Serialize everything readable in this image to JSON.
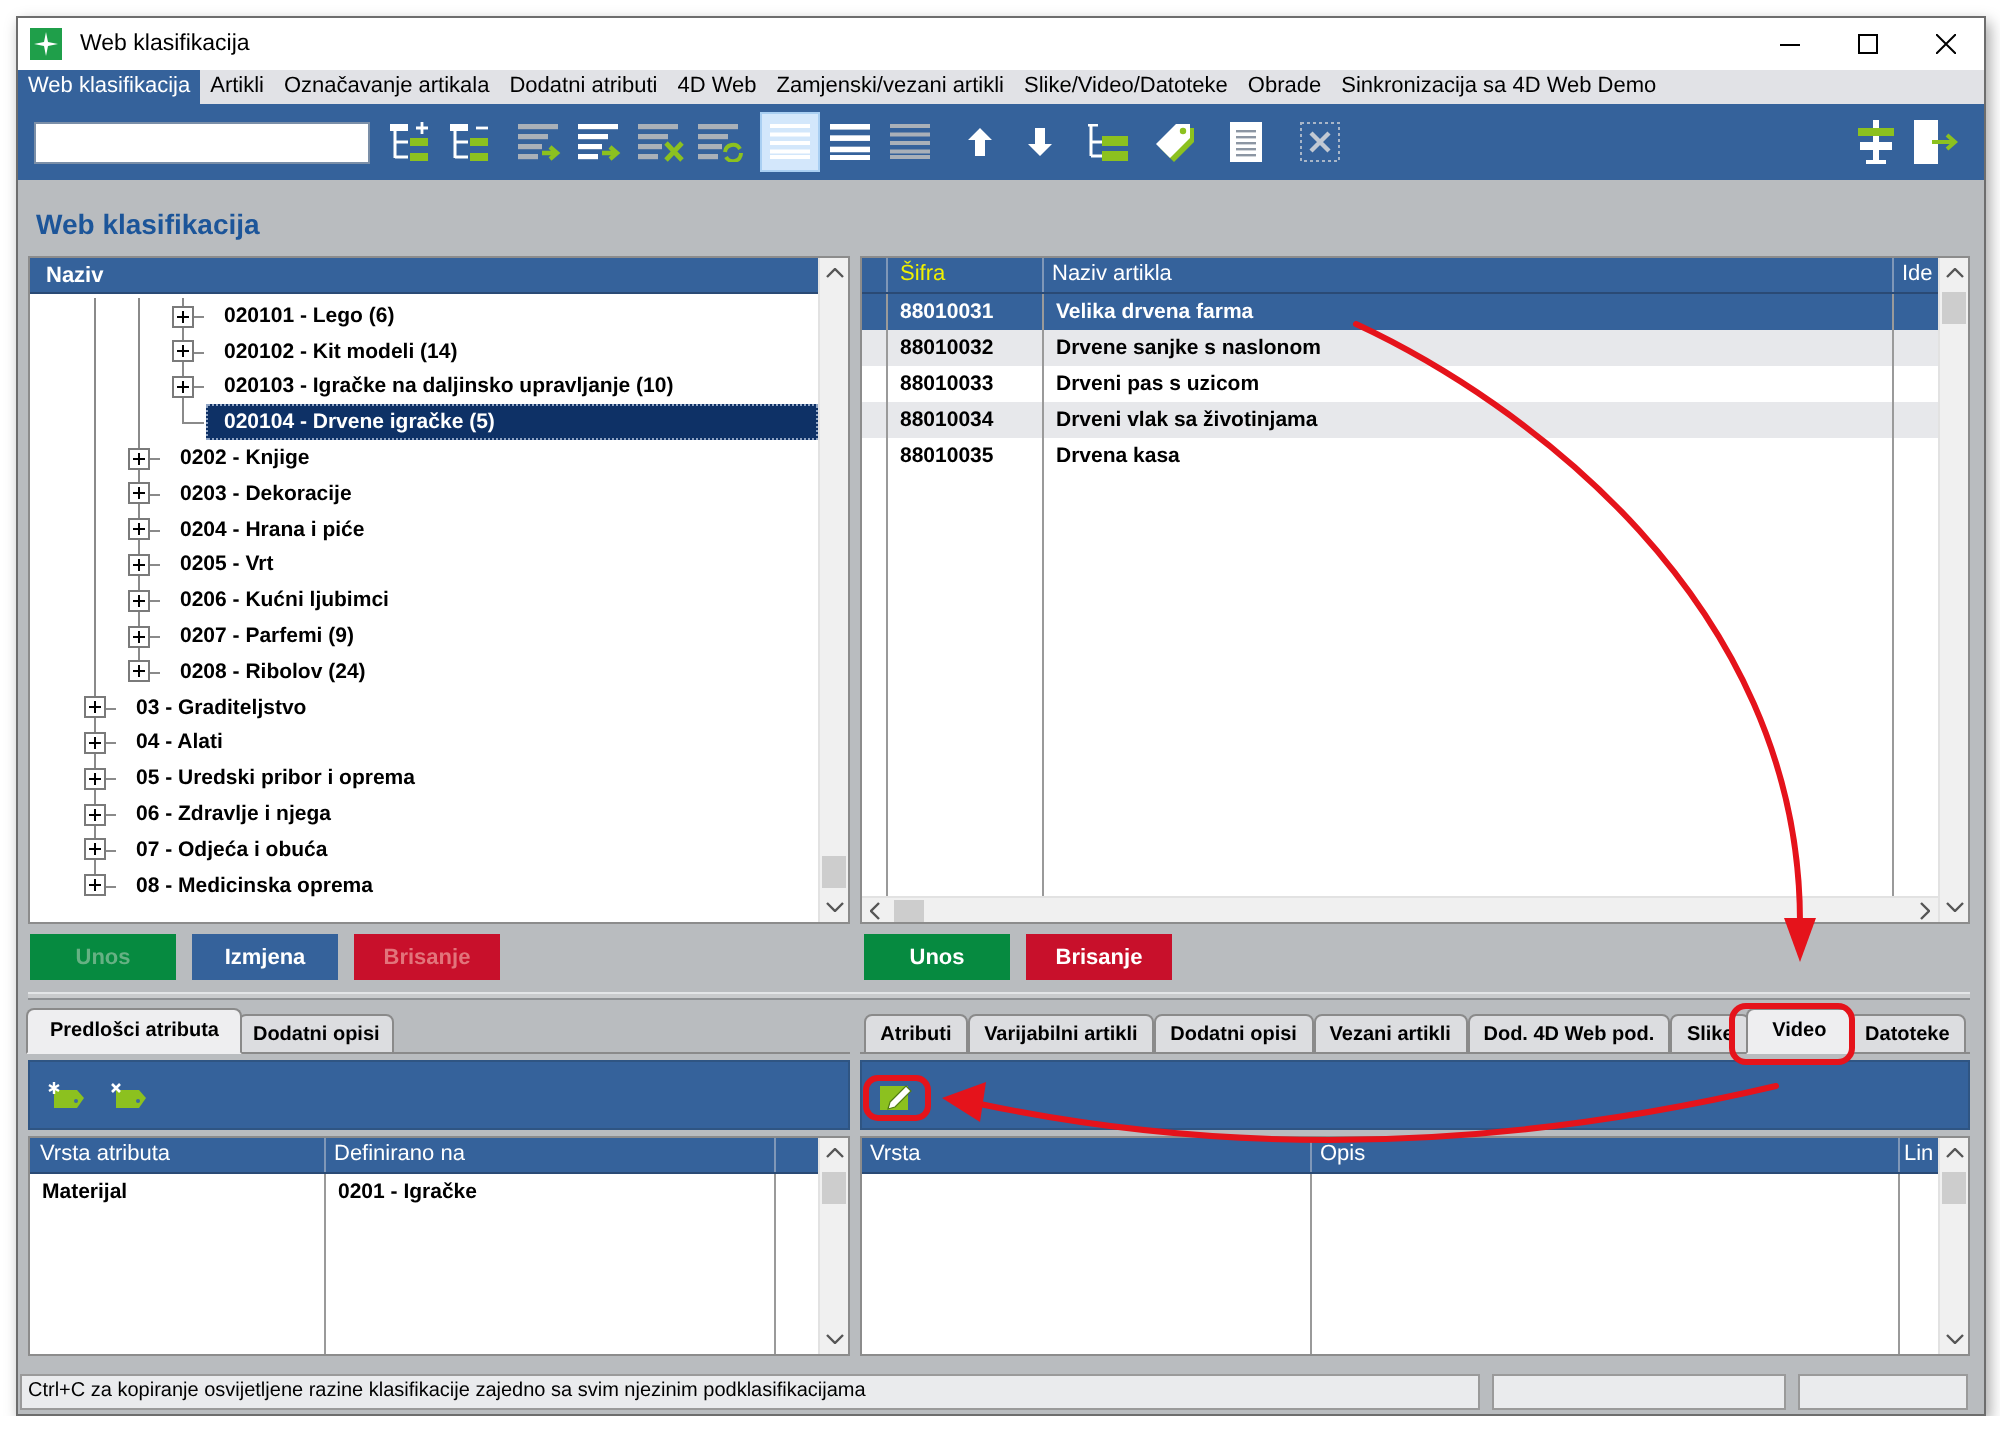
{
  "window": {
    "title": "Web klasifikacija"
  },
  "menu": [
    {
      "label": "Web klasifikacija",
      "selected": true
    },
    {
      "label": "Artikli",
      "selected": false
    },
    {
      "label": "Označavanje artikala",
      "selected": false
    },
    {
      "label": "Dodatni atributi",
      "selected": false
    },
    {
      "label": "4D Web",
      "selected": false
    },
    {
      "label": "Zamjenski/vezani artikli",
      "selected": false
    },
    {
      "label": "Slike/Video/Datoteke",
      "selected": false
    },
    {
      "label": "Obrade",
      "selected": false
    },
    {
      "label": "Sinkronizacija sa 4D Web Demo",
      "selected": false
    }
  ],
  "toolbar": {
    "view_buttons": [
      {
        "selected": true
      },
      {
        "selected": false
      },
      {
        "selected": false
      }
    ]
  },
  "heading": "Web klasifikacija",
  "tree": {
    "header": "Naziv",
    "items": [
      {
        "children": [
          {
            "children": [
              {
                "label": "020101 - Lego (6)",
                "expanded": false,
                "selected": false
              },
              {
                "label": "020102 - Kit modeli (14)",
                "expanded": false,
                "selected": false
              },
              {
                "label": "020103 - Igračke na daljinsko upravljanje (10)",
                "expanded": false,
                "selected": false
              },
              {
                "label": "020104 - Drvene igračke (5)",
                "selected": true
              }
            ]
          },
          {
            "label": "0202 - Knjige",
            "expanded": false,
            "selected": false
          },
          {
            "label": "0203 - Dekoracije",
            "expanded": false,
            "selected": false
          },
          {
            "label": "0204 - Hrana i piće",
            "expanded": false,
            "selected": false
          },
          {
            "label": "0205 - Vrt",
            "expanded": false,
            "selected": false
          },
          {
            "label": "0206 - Kućni ljubimci",
            "expanded": false,
            "selected": false
          },
          {
            "label": "0207 - Parfemi (9)",
            "expanded": false,
            "selected": false
          },
          {
            "label": "0208 - Ribolov (24)",
            "expanded": false,
            "selected": false
          }
        ]
      },
      {
        "label": "03 - Graditeljstvo",
        "expanded": false,
        "selected": false
      },
      {
        "label": "04 - Alati",
        "expanded": false,
        "selected": false
      },
      {
        "label": "05 - Uredski pribor i oprema",
        "expanded": false,
        "selected": false
      },
      {
        "label": "06 - Zdravlje i njega",
        "expanded": false,
        "selected": false
      },
      {
        "label": "07 - Odjeća i obuća",
        "expanded": false,
        "selected": false
      },
      {
        "label": "08 - Medicinska oprema",
        "expanded": false,
        "selected": false
      }
    ]
  },
  "tree_buttons": [
    {
      "label": "Unos",
      "kind": "add",
      "disabled": true
    },
    {
      "label": "Izmjena",
      "kind": "edit",
      "disabled": false
    },
    {
      "label": "Brisanje",
      "kind": "delete",
      "disabled": true
    }
  ],
  "articles": {
    "columns": [
      {
        "label": "Šifra",
        "highlighted": true
      },
      {
        "label": "Naziv artikla",
        "highlighted": false
      },
      {
        "label": "Ide",
        "highlighted": false
      }
    ],
    "rows": [
      {
        "cells": [
          "88010031",
          "Velika drvena farma"
        ],
        "selected": true
      },
      {
        "cells": [
          "88010032",
          "Drvene sanjke s naslonom"
        ],
        "selected": false
      },
      {
        "cells": [
          "88010033",
          "Drveni pas s uzicom"
        ],
        "selected": false
      },
      {
        "cells": [
          "88010034",
          "Drveni vlak sa životinjama"
        ],
        "selected": false
      },
      {
        "cells": [
          "88010035",
          "Drvena kasa"
        ],
        "selected": false
      }
    ]
  },
  "article_buttons": [
    {
      "label": "Unos",
      "kind": "add",
      "disabled": false
    },
    {
      "label": "Brisanje",
      "kind": "delete",
      "disabled": false
    }
  ],
  "attributes": {
    "tabs": [
      {
        "label": "Predlošci atributa",
        "selected": true
      },
      {
        "label": "Dodatni opisi",
        "selected": false
      }
    ],
    "columns": [
      {
        "label": "Vrsta atributa"
      },
      {
        "label": "Definirano na"
      }
    ],
    "rows": [
      {
        "cells": [
          "Materijal",
          "0201 - Igračke"
        ]
      }
    ]
  },
  "details": {
    "tabs": [
      {
        "label": "Atributi",
        "selected": false
      },
      {
        "label": "Varijabilni artikli",
        "selected": false
      },
      {
        "label": "Dodatni opisi",
        "selected": false
      },
      {
        "label": "Vezani artikli",
        "selected": false
      },
      {
        "label": "Dod. 4D Web pod.",
        "selected": false
      },
      {
        "label": "Slike",
        "selected": false
      },
      {
        "label": "Video",
        "selected": true
      },
      {
        "label": "Datoteke",
        "selected": false
      }
    ],
    "columns": [
      {
        "label": "Vrsta"
      },
      {
        "label": "Opis"
      },
      {
        "label": "Lin"
      }
    ]
  },
  "status_bar": {
    "message": "Ctrl+C za kopiranje osvijetljene razine klasifikacije zajedno sa svim njezinim podklasifikacijama"
  }
}
